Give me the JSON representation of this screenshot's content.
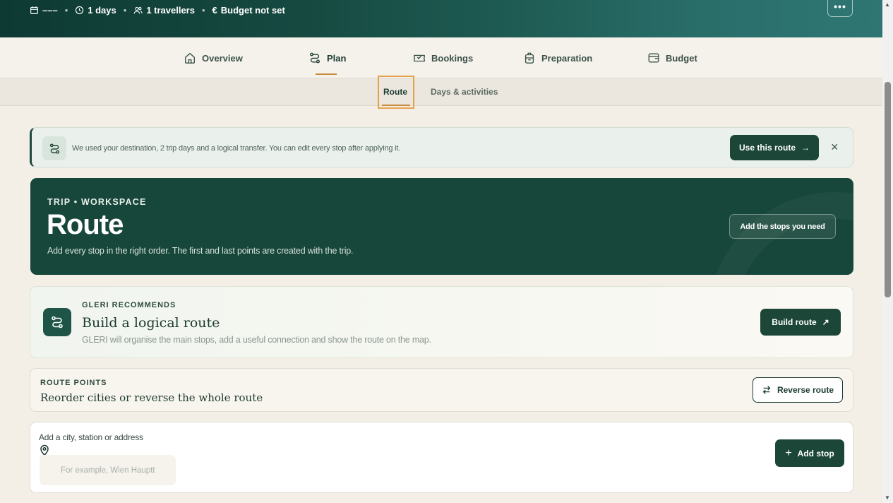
{
  "hero": {
    "dates": "–––",
    "days": "1 days",
    "travellers": "1 travellers",
    "budget": "Budget not set",
    "more_label": "•••"
  },
  "main_nav": [
    {
      "label": "Overview",
      "icon": "home-icon"
    },
    {
      "label": "Plan",
      "icon": "route-icon",
      "active": true
    },
    {
      "label": "Bookings",
      "icon": "ticket-icon"
    },
    {
      "label": "Preparation",
      "icon": "luggage-icon"
    },
    {
      "label": "Budget",
      "icon": "wallet-icon"
    }
  ],
  "sub_nav": [
    {
      "label": "Route",
      "active": true
    },
    {
      "label": "Days & activities"
    }
  ],
  "banner": {
    "text": "We used your destination, 2 trip days and a logical transfer. You can edit every stop after applying it.",
    "button": "Use this route",
    "close": "×"
  },
  "workspace": {
    "eyebrow": "TRIP • WORKSPACE",
    "title": "Route",
    "description": "Add every stop in the right order. The first and last points are created with the trip.",
    "button": "Add the stops you need"
  },
  "recommend": {
    "eyebrow": "GLERI RECOMMENDS",
    "title": "Build a logical route",
    "description": "GLERI will organise the main stops, add a useful connection and show the route on the map.",
    "button": "Build route"
  },
  "route_points": {
    "eyebrow": "ROUTE POINTS",
    "title": "Reorder cities or reverse the whole route",
    "button": "Reverse route"
  },
  "add_stop": {
    "label": "Add a city, station or address",
    "placeholder": "For example, Wien Hauptt",
    "button": "Add stop"
  },
  "colors": {
    "accent": "#c88a3a",
    "dark_green": "#1b4638",
    "highlight": "#e5a24d"
  }
}
